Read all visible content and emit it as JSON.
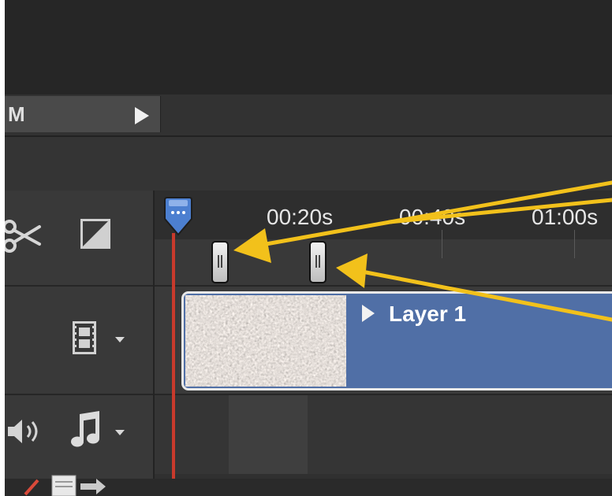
{
  "playback": {
    "mode_label": "M",
    "play_icon": "play-icon"
  },
  "tools": {
    "cut_icon": "scissors-icon",
    "split_icon": "split-icon"
  },
  "ruler": {
    "ticks": [
      "00:20s",
      "00:40s",
      "01:00s"
    ]
  },
  "tracks": {
    "video": {
      "icon": "film-icon",
      "clip_title": "Layer 1"
    },
    "audio": {
      "volume_icon": "speaker-icon",
      "music_icon": "music-note-icon"
    }
  },
  "annotations": {
    "arrow_color": "#f2c11b",
    "arrow_count": 3
  },
  "colors": {
    "clip_blue": "#506fa6",
    "playhead_red": "#c83a2c",
    "playhead_blue": "#4c7fd0"
  }
}
